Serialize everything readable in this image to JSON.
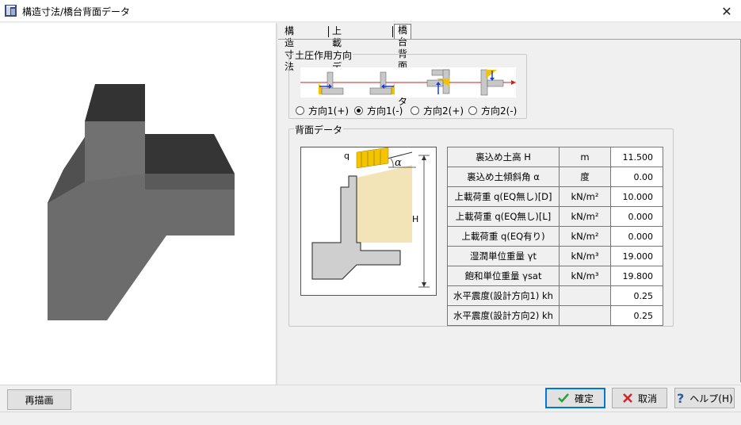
{
  "window": {
    "title": "構造寸法/橋台背面データ",
    "close_glyph": "✕"
  },
  "tabs": [
    {
      "label": "構造寸法",
      "active": false
    },
    {
      "label": "上載土データ",
      "active": false
    },
    {
      "label": "橋台背面データ",
      "active": true
    }
  ],
  "direction_group": {
    "title": "土圧作用方向",
    "options": [
      {
        "label": "方向1(+)",
        "selected": false
      },
      {
        "label": "方向1(-)",
        "selected": true
      },
      {
        "label": "方向2(+)",
        "selected": false
      },
      {
        "label": "方向2(-)",
        "selected": false
      }
    ]
  },
  "back_group": {
    "title": "背面データ",
    "diagram": {
      "q_label": "q",
      "alpha_label": "α",
      "h_label": "H"
    },
    "rows": [
      {
        "label": "裏込め土高 H",
        "unit": "m",
        "value": "11.500"
      },
      {
        "label": "裏込め土傾斜角 α",
        "unit": "度",
        "value": "0.00"
      },
      {
        "label": "上載荷重 q(EQ無し)[D]",
        "unit": "kN/m²",
        "value": "10.000"
      },
      {
        "label": "上載荷重 q(EQ無し)[L]",
        "unit": "kN/m²",
        "value": "0.000"
      },
      {
        "label": "上載荷重 q(EQ有り)",
        "unit": "kN/m²",
        "value": "0.000"
      },
      {
        "label": "湿潤単位重量 γt",
        "unit": "kN/m³",
        "value": "19.000"
      },
      {
        "label": "飽和単位重量 γsat",
        "unit": "kN/m³",
        "value": "19.800"
      },
      {
        "label": "水平震度(設計方向1) kh",
        "unit": "",
        "value": "0.25"
      },
      {
        "label": "水平震度(設計方向2) kh",
        "unit": "",
        "value": "0.25"
      }
    ]
  },
  "buttons": {
    "redraw": "再描画",
    "ok": "確定",
    "cancel": "取消",
    "help": "ヘルプ(H)"
  },
  "icons": {
    "app": "app-icon",
    "ok": "check-icon",
    "cancel": "cross-icon",
    "help": "question-icon"
  },
  "colors": {
    "accent": "#0078d7",
    "ok_check": "#2e9e3a",
    "cancel_cross": "#d4262a",
    "help_blue": "#1f5fb3",
    "soil": "#f3e4b8",
    "load": "#f5c400"
  }
}
